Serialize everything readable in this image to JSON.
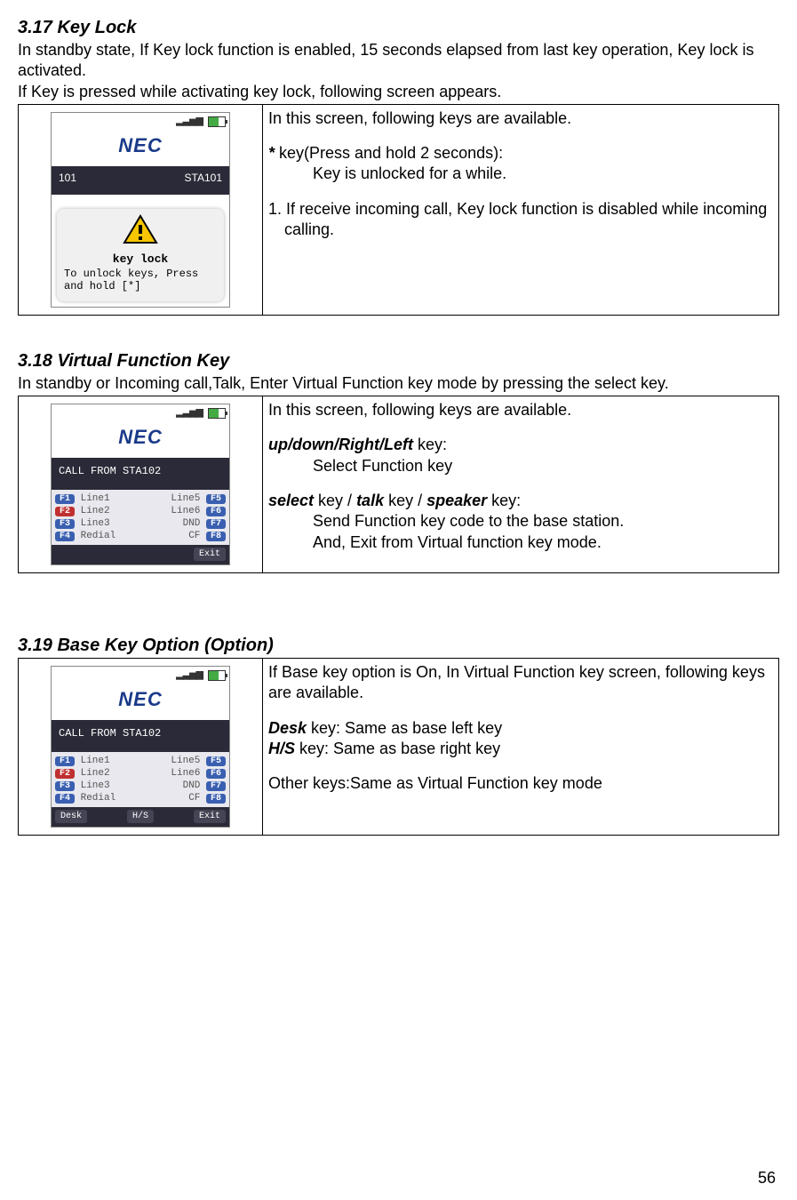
{
  "sections": {
    "s1": {
      "heading": "3.17  Key Lock",
      "intro1": "In standby state, If Key lock function is enabled, 15 seconds elapsed from last key operation, Key lock is activated.",
      "intro2": "If Key is pressed while activating key lock, following screen appears.",
      "desc_avail": "In this screen, following keys are available.",
      "star_key": "*",
      "star_line": " key(Press and hold 2 seconds):",
      "star_sub": "Key is unlocked for a while.",
      "note1": "1. If receive incoming call, Key lock function is disabled while incoming calling.",
      "phone": {
        "brand": "NEC",
        "left": "101",
        "right": "STA101",
        "panel_title": "key lock",
        "panel_text": "To unlock keys, Press and hold [*]"
      }
    },
    "s2": {
      "heading": "3.18  Virtual Function Key",
      "intro1_a": "In standby or Incoming call,Talk, Enter Virtual Function key mode by pressing the ",
      "intro1_key": "select",
      "intro1_b": " key.",
      "desc_avail": "In this screen, following keys are available.",
      "nav_key": "up/down/Right/Left",
      "nav_tail": " key:",
      "nav_sub": "Select Function key",
      "sel_key1": "select",
      "sel_mid1": " key / ",
      "sel_key2": "talk",
      "sel_mid2": " key / ",
      "sel_key3": "speaker",
      "sel_tail": " key:",
      "sel_sub1": "Send Function key code to the base station.",
      "sel_sub2": "And, Exit from Virtual function key mode.",
      "phone": {
        "brand": "NEC",
        "callfrom": "CALL FROM   STA102",
        "rows": [
          {
            "lb": "F1",
            "ll": "Line1",
            "rl": "Line5",
            "rb": "F5",
            "lred": false
          },
          {
            "lb": "F2",
            "ll": "Line2",
            "rl": "Line6",
            "rb": "F6",
            "lred": true
          },
          {
            "lb": "F3",
            "ll": "Line3",
            "rl": "DND",
            "rb": "F7",
            "lred": false
          },
          {
            "lb": "F4",
            "ll": "Redial",
            "rl": "CF",
            "rb": "F8",
            "lred": false
          }
        ],
        "soft_right": "Exit"
      }
    },
    "s3": {
      "heading": "3.19  Base Key Option (Option)",
      "desc_intro": "If Base key option is On, In Virtual Function key screen, following keys are available.",
      "desk_key": "Desk",
      "desk_tail": " key:  Same as base left key",
      "hs_key": "H/S",
      "hs_tail": " key:  Same as base right key",
      "other": "Other keys:Same as Virtual Function key mode",
      "phone": {
        "brand": "NEC",
        "callfrom": "CALL FROM   STA102",
        "rows": [
          {
            "lb": "F1",
            "ll": "Line1",
            "rl": "Line5",
            "rb": "F5",
            "lred": false
          },
          {
            "lb": "F2",
            "ll": "Line2",
            "rl": "Line6",
            "rb": "F6",
            "lred": true
          },
          {
            "lb": "F3",
            "ll": "Line3",
            "rl": "DND",
            "rb": "F7",
            "lred": false
          },
          {
            "lb": "F4",
            "ll": "Redial",
            "rl": "CF",
            "rb": "F8",
            "lred": false
          }
        ],
        "soft_left": "Desk",
        "soft_mid": "H/S",
        "soft_right": "Exit"
      }
    }
  },
  "page_number": "56"
}
